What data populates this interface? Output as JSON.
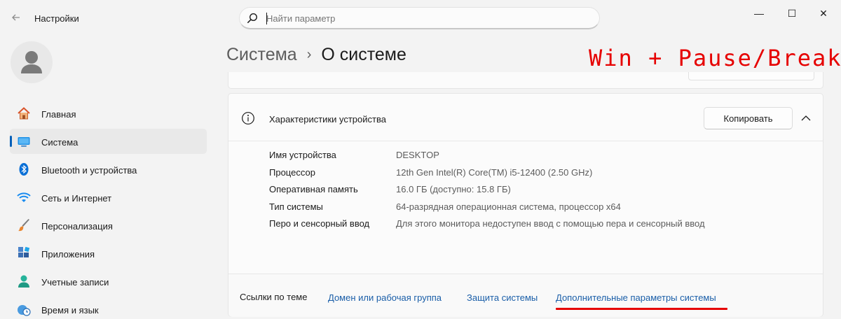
{
  "window": {
    "title": "Настройки",
    "controls": {
      "minimize": "—",
      "maximize": "☐",
      "close": "✕"
    }
  },
  "search": {
    "placeholder": "Найти параметр"
  },
  "sidebar": {
    "items": [
      {
        "label": "Главная",
        "icon": "home-icon"
      },
      {
        "label": "Система",
        "icon": "system-display-icon",
        "active": true
      },
      {
        "label": "Bluetooth и устройства",
        "icon": "bluetooth-icon"
      },
      {
        "label": "Сеть и Интернет",
        "icon": "wifi-icon"
      },
      {
        "label": "Персонализация",
        "icon": "brush-icon"
      },
      {
        "label": "Приложения",
        "icon": "apps-icon"
      },
      {
        "label": "Учетные записи",
        "icon": "user-icon"
      },
      {
        "label": "Время и язык",
        "icon": "clock-globe-icon"
      }
    ]
  },
  "header": {
    "parent": "Система",
    "separator": "›",
    "current": "О системе"
  },
  "annotation": {
    "hotkey": "Win + Pause/Break"
  },
  "device_card": {
    "title": "Характеристики устройства",
    "copy_label": "Копировать",
    "specs": [
      {
        "key": "Имя устройства",
        "value": "DESKTOP"
      },
      {
        "key": "Процессор",
        "value": "12th Gen Intel(R) Core(TM) i5-12400 (2.50 GHz)"
      },
      {
        "key": "Оперативная память",
        "value": "16.0 ГБ (доступно: 15.8 ГБ)"
      },
      {
        "key": "Тип системы",
        "value": "64-разрядная операционная система, процессор x64"
      },
      {
        "key": "Перо и сенсорный ввод",
        "value": "Для этого монитора недоступен ввод с помощью пера и сенсорный ввод"
      }
    ]
  },
  "related": {
    "title": "Ссылки по теме",
    "links": [
      "Домен или рабочая группа",
      "Защита системы",
      "Дополнительные параметры системы"
    ]
  },
  "colors": {
    "accent": "#005fb8",
    "link": "#1a5ea8",
    "annotation_red": "#e60000"
  }
}
